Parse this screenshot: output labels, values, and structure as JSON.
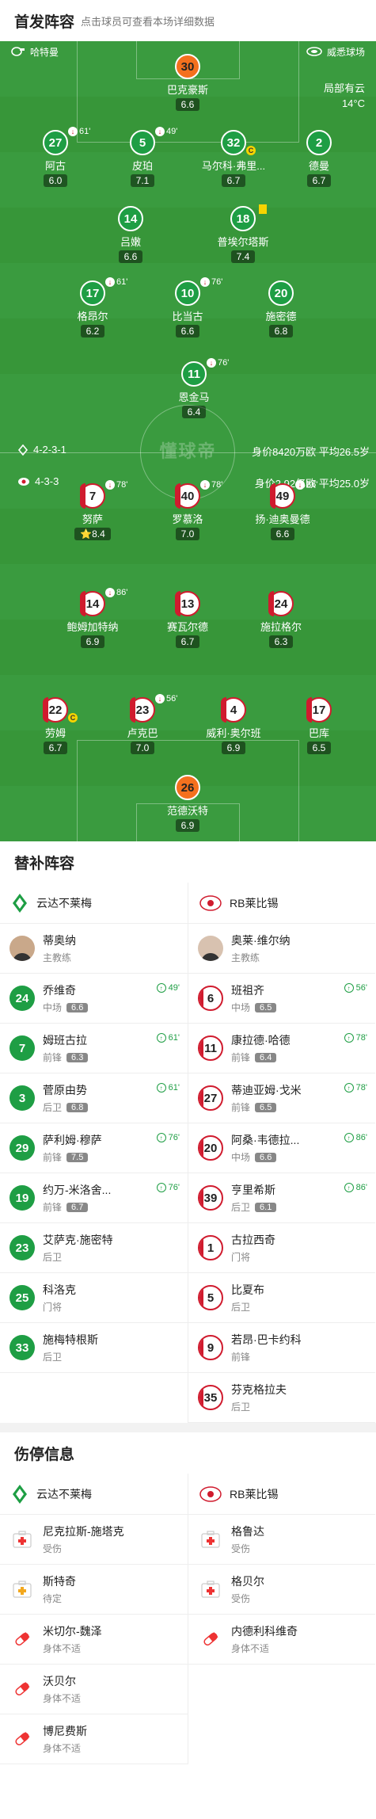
{
  "header": {
    "title": "首发阵容",
    "hint": "点击球员可查看本场详细数据"
  },
  "pitch": {
    "coach_home": "哈特曼",
    "coach_away": "威悉球场",
    "weather_line1": "局部有云",
    "weather_line2": "14°C",
    "watermark": "懂球帝",
    "home_formation": "4-2-3-1",
    "home_info": "身价8420万欧 平均26.5岁",
    "away_formation": "4-3-3",
    "away_info": "身价2.92亿欧 平均25.0岁"
  },
  "home_players": [
    {
      "num": "30",
      "name": "巴克豪斯",
      "rating": "6.6",
      "gk": true
    },
    {
      "num": "27",
      "name": "阿古",
      "rating": "6.0",
      "sub": "61'"
    },
    {
      "num": "5",
      "name": "皮珀",
      "rating": "7.1",
      "sub": "49'"
    },
    {
      "num": "32",
      "name": "马尔科·弗里...",
      "rating": "6.7",
      "captain": "C"
    },
    {
      "num": "2",
      "name": "德曼",
      "rating": "6.7"
    },
    {
      "num": "14",
      "name": "吕嫩",
      "rating": "6.6"
    },
    {
      "num": "18",
      "name": "普埃尔塔斯",
      "rating": "7.4"
    },
    {
      "num": "17",
      "name": "格昂尔",
      "rating": "6.2",
      "sub": "61'"
    },
    {
      "num": "10",
      "name": "比当古",
      "rating": "6.6",
      "sub": "76'"
    },
    {
      "num": "20",
      "name": "施密德",
      "rating": "6.8"
    },
    {
      "num": "11",
      "name": "恩金马",
      "rating": "6.4",
      "sub": "76'"
    }
  ],
  "away_players": [
    {
      "num": "7",
      "name": "努萨",
      "rating": "8.4",
      "sub": "78'",
      "star": "⭐"
    },
    {
      "num": "40",
      "name": "罗慕洛",
      "rating": "7.0",
      "sub": "78'"
    },
    {
      "num": "49",
      "name": "扬·迪奥曼德",
      "rating": "6.6",
      "sub": "86'"
    },
    {
      "num": "14",
      "name": "鲍姆加特纳",
      "rating": "6.9",
      "sub": "86'"
    },
    {
      "num": "13",
      "name": "赛瓦尔德",
      "rating": "6.7"
    },
    {
      "num": "24",
      "name": "施拉格尔",
      "rating": "6.3"
    },
    {
      "num": "22",
      "name": "劳姆",
      "rating": "6.7",
      "captain": "C"
    },
    {
      "num": "23",
      "name": "卢克巴",
      "rating": "7.0",
      "sub": "56'"
    },
    {
      "num": "4",
      "name": "威利·奥尔班",
      "rating": "6.9"
    },
    {
      "num": "17",
      "name": "巴库",
      "rating": "6.5"
    },
    {
      "num": "26",
      "name": "范德沃特",
      "rating": "6.9",
      "gk": true
    }
  ],
  "subs": {
    "title": "替补阵容",
    "home_team": "云达不莱梅",
    "away_team": "RB莱比锡",
    "home_coach": {
      "name": "蒂奥纳",
      "role": "主教练"
    },
    "away_coach": {
      "name": "奥莱·维尔纳",
      "role": "主教练"
    },
    "home": [
      {
        "num": "24",
        "name": "乔维奇",
        "pos": "中场",
        "rating": "6.6",
        "ev": "49'"
      },
      {
        "num": "7",
        "name": "姆班古拉",
        "pos": "前锋",
        "rating": "6.3",
        "ev": "61'"
      },
      {
        "num": "3",
        "name": "菅原由势",
        "pos": "后卫",
        "rating": "6.8",
        "ev": "61'"
      },
      {
        "num": "29",
        "name": "萨利姆·穆萨",
        "pos": "前锋",
        "rating": "7.5",
        "ev": "76'"
      },
      {
        "num": "19",
        "name": "约万-米洛舍...",
        "pos": "前锋",
        "rating": "6.7",
        "ev": "76'"
      },
      {
        "num": "23",
        "name": "艾萨克·施密特",
        "pos": "后卫",
        "rating": "",
        "ev": ""
      },
      {
        "num": "25",
        "name": "科洛克",
        "pos": "门将",
        "rating": "",
        "ev": ""
      },
      {
        "num": "33",
        "name": "施梅特根斯",
        "pos": "后卫",
        "rating": "",
        "ev": ""
      }
    ],
    "away": [
      {
        "num": "6",
        "name": "班祖齐",
        "pos": "中场",
        "rating": "6.5",
        "ev": "56'"
      },
      {
        "num": "11",
        "name": "康拉德·哈德",
        "pos": "前锋",
        "rating": "6.4",
        "ev": "78'"
      },
      {
        "num": "27",
        "name": "蒂迪亚姆·戈米",
        "pos": "前锋",
        "rating": "6.5",
        "ev": "78'"
      },
      {
        "num": "20",
        "name": "阿桑·韦德拉...",
        "pos": "中场",
        "rating": "6.6",
        "ev": "86'"
      },
      {
        "num": "39",
        "name": "亨里希斯",
        "pos": "后卫",
        "rating": "6.1",
        "ev": "86'"
      },
      {
        "num": "1",
        "name": "古拉西奇",
        "pos": "门将",
        "rating": "",
        "ev": ""
      },
      {
        "num": "5",
        "name": "比夏布",
        "pos": "后卫",
        "rating": "",
        "ev": ""
      },
      {
        "num": "9",
        "name": "若昂·巴卡约科",
        "pos": "前锋",
        "rating": "",
        "ev": ""
      },
      {
        "num": "35",
        "name": "芬克格拉夫",
        "pos": "后卫",
        "rating": "",
        "ev": ""
      }
    ]
  },
  "injuries": {
    "title": "伤停信息",
    "home": [
      {
        "name": "尼克拉斯-施塔克",
        "status": "受伤",
        "type": "injury"
      },
      {
        "name": "斯特奇",
        "status": "待定",
        "type": "doubt"
      },
      {
        "name": "米切尔-魏泽",
        "status": "身体不适",
        "type": "ill"
      },
      {
        "name": "沃贝尔",
        "status": "身体不适",
        "type": "ill"
      },
      {
        "name": "博尼费斯",
        "status": "身体不适",
        "type": "ill"
      }
    ],
    "away": [
      {
        "name": "格鲁达",
        "status": "受伤",
        "type": "injury"
      },
      {
        "name": "格贝尔",
        "status": "受伤",
        "type": "injury"
      },
      {
        "name": "内德利科维奇",
        "status": "身体不适",
        "type": "ill"
      }
    ]
  }
}
